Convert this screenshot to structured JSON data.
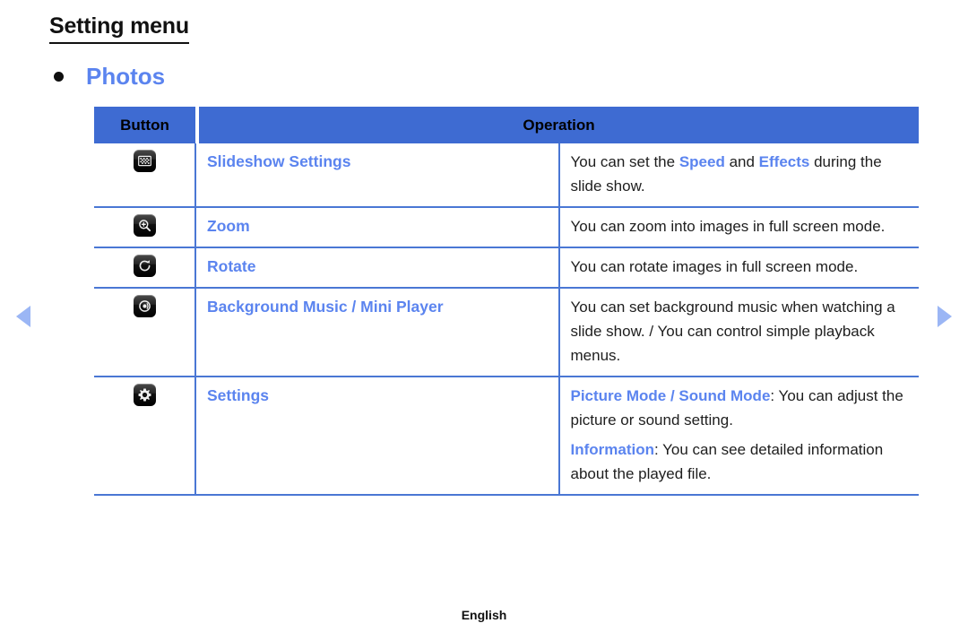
{
  "page": {
    "title": "Setting menu",
    "section_bullet_label": "Photos",
    "footer_language": "English",
    "accent_blue": "#5b84ef",
    "header_blue": "#3e6bd2",
    "border_blue": "#4a77d4",
    "arrow_blue": "#9bb6f5"
  },
  "nav": {
    "prev_label": "previous-page",
    "next_label": "next-page"
  },
  "table": {
    "columns": [
      {
        "key": "button",
        "label": "Button"
      },
      {
        "key": "operation",
        "label": "Operation"
      }
    ],
    "rows": [
      {
        "icon": "slideshow-settings-icon",
        "label": "Slideshow Settings",
        "paragraphs": [
          [
            {
              "t": "You can set the ",
              "hl": false
            },
            {
              "t": "Speed",
              "hl": true
            },
            {
              "t": " and ",
              "hl": false
            },
            {
              "t": "Effects",
              "hl": true
            },
            {
              "t": " during the slide show.",
              "hl": false
            }
          ]
        ]
      },
      {
        "icon": "zoom-in-icon",
        "label": "Zoom",
        "paragraphs": [
          [
            {
              "t": "You can zoom into images in full screen mode.",
              "hl": false
            }
          ]
        ]
      },
      {
        "icon": "rotate-icon",
        "label": "Rotate",
        "paragraphs": [
          [
            {
              "t": "You can rotate images in full screen mode.",
              "hl": false
            }
          ]
        ]
      },
      {
        "icon": "background-music-disc-icon",
        "label": "Background Music / Mini Player",
        "paragraphs": [
          [
            {
              "t": "You can set background music when watching a slide show. / You can control simple playback menus.",
              "hl": false
            }
          ]
        ]
      },
      {
        "icon": "settings-gear-icon",
        "label": "Settings",
        "paragraphs": [
          [
            {
              "t": "Picture Mode / Sound Mode",
              "hl": true
            },
            {
              "t": ": You can adjust the picture or sound setting.",
              "hl": false
            }
          ],
          [
            {
              "t": "Information",
              "hl": true
            },
            {
              "t": ": You can see detailed information about the played file.",
              "hl": false
            }
          ]
        ]
      }
    ]
  }
}
